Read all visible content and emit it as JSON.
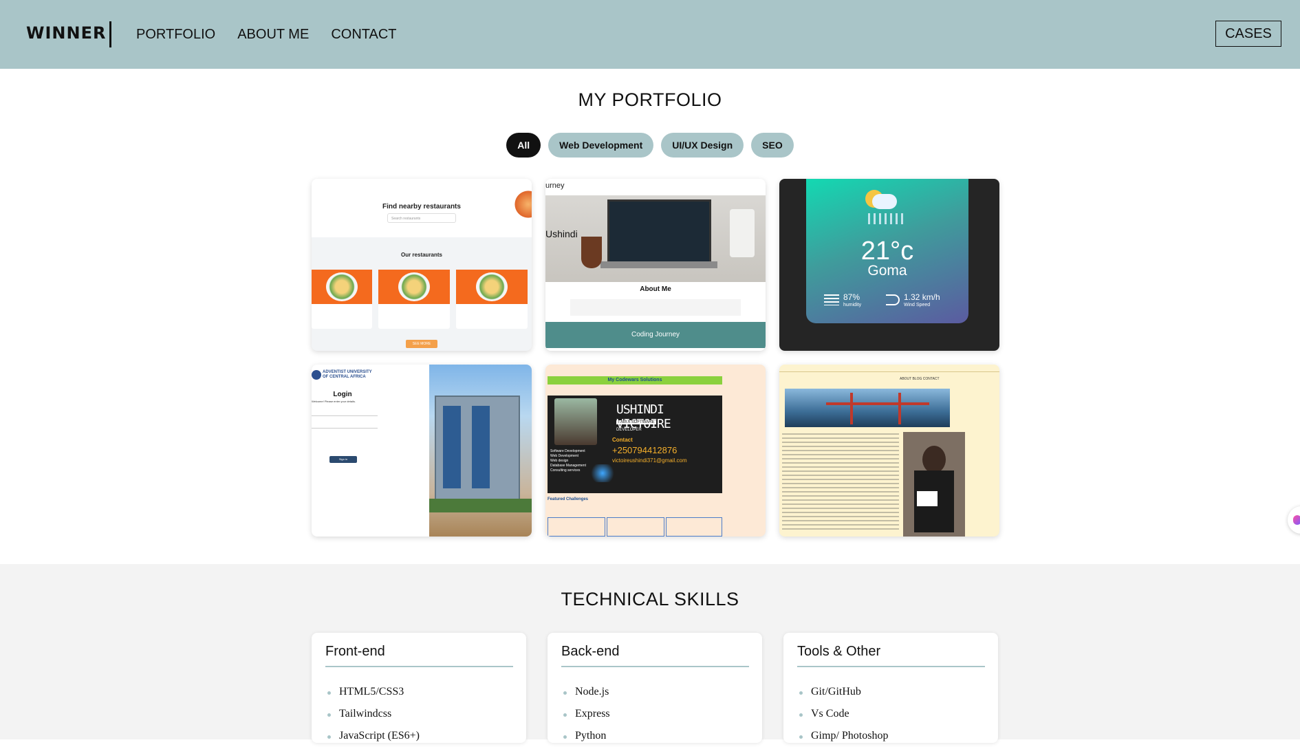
{
  "header": {
    "logo": "WINNER",
    "nav": [
      "PORTFOLIO",
      "ABOUT ME",
      "CONTACT"
    ],
    "cta": "CASES"
  },
  "portfolio": {
    "title": "MY PORTFOLIO",
    "filters": [
      "All",
      "Web Development",
      "UI/UX Design",
      "SEO"
    ],
    "active_filter": "All",
    "cards": {
      "restaurants": {
        "heading": "Find nearby restaurants",
        "search_placeholder": "Search restaurants",
        "subheading": "Our restaurants",
        "button": "SEE MORE"
      },
      "journey": {
        "top_text": "urney",
        "name": "Ushindi",
        "about": "About Me",
        "bar": "Coding Journey"
      },
      "weather": {
        "temp": "21°c",
        "city": "Goma",
        "humidity_value": "87%",
        "humidity_label": "humidity",
        "wind_value": "1.32 km/h",
        "wind_label": "Wind Speed"
      },
      "login": {
        "org_line1": "ADVENTIST UNIVERSITY",
        "org_line2": "OF CENTRAL AFRICA",
        "title": "Login",
        "subtitle": "Welcome! Please enter your details.",
        "button": "Sign in"
      },
      "codewars": {
        "banner": "My Codewars Solutions",
        "name": "USHINDI VICTOIRE",
        "role_line1": "I AM A SOFTWARE",
        "role_line2": "DEVELOPER",
        "contact_label": "Contact",
        "phone": "+250794412876",
        "email": "victoireushindi371@gmail.com",
        "skills": [
          "Software Development",
          "Web Development",
          "Web design",
          "Database Management",
          "Consulting services"
        ],
        "featured": "Featured Challenges"
      },
      "blog": {
        "nav": "ABOUT  BLOG  CONTACT"
      }
    }
  },
  "skills": {
    "title": "TECHNICAL SKILLS",
    "groups": [
      {
        "title": "Front-end",
        "items": [
          "HTML5/CSS3",
          "Tailwindcss",
          "JavaScript (ES6+)"
        ]
      },
      {
        "title": "Back-end",
        "items": [
          "Node.js",
          "Express",
          "Python"
        ]
      },
      {
        "title": "Tools & Other",
        "items": [
          "Git/GitHub",
          "Vs Code",
          "Gimp/ Photoshop"
        ]
      }
    ]
  },
  "colors": {
    "header_bg": "#a9c5c8",
    "accent": "#a9c5c8",
    "active_pill": "#111111",
    "restaurant_orange": "#f46a1e",
    "journey_teal": "#4f8d8b"
  }
}
